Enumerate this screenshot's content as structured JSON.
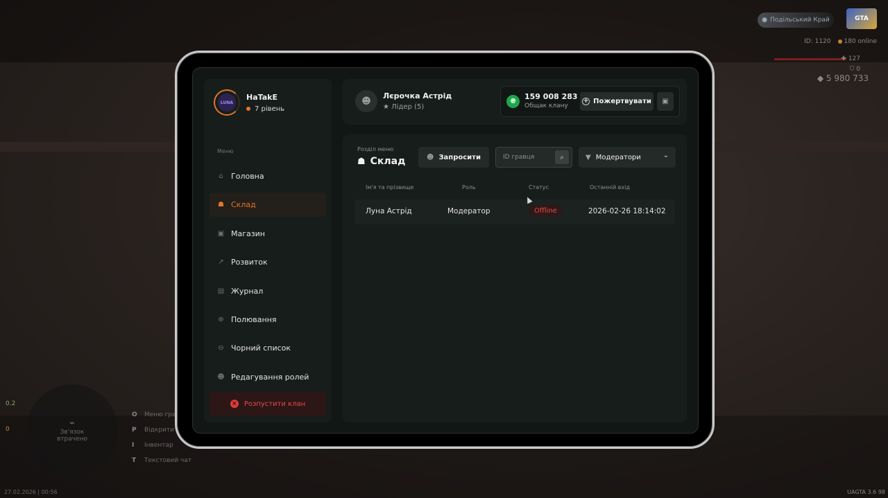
{
  "hud": {
    "server": "Подільський Край",
    "logo": "GTA",
    "id": "ID: 1120",
    "online": "180 online",
    "hp": "127",
    "armor": "0",
    "money": "5 980 733",
    "radar_text": "Зв'язок втрачено",
    "side_stats": [
      "0.2",
      "0"
    ],
    "keys": [
      {
        "key": "O",
        "label": "Меню гравця"
      },
      {
        "key": "P",
        "label": "Відкрити"
      },
      {
        "key": "I",
        "label": "Інвентар"
      },
      {
        "key": "T",
        "label": "Текстовий чат"
      }
    ],
    "datetime": "27.02.2026 | 00:56",
    "version": "UAGTA 3.6",
    "version_extra": "98"
  },
  "profile": {
    "name": "HaTakE",
    "level": "7 рівень",
    "avatar_text": "LUNA"
  },
  "sidebar": {
    "caption": "Меню",
    "items": [
      {
        "label": "Головна",
        "icon": "home-icon",
        "glyph": "⌂"
      },
      {
        "label": "Склад",
        "icon": "members-icon",
        "glyph": "☗"
      },
      {
        "label": "Магазин",
        "icon": "shop-icon",
        "glyph": "▣"
      },
      {
        "label": "Розвиток",
        "icon": "chart-icon",
        "glyph": "↗"
      },
      {
        "label": "Журнал",
        "icon": "journal-icon",
        "glyph": "▤"
      },
      {
        "label": "Полювання",
        "icon": "crosshair-icon",
        "glyph": "⊕"
      },
      {
        "label": "Чорний список",
        "icon": "blocked-icon",
        "glyph": "⊖"
      },
      {
        "label": "Редагування ролей",
        "icon": "user-edit-icon",
        "glyph": "☻"
      }
    ],
    "active_index": 1,
    "dissolve_label": "Розпустити клан"
  },
  "leader": {
    "name": "Лєрочка Астрід",
    "role": "Лідер (5)"
  },
  "fund": {
    "value": "159 008 283",
    "label": "Общак клану",
    "donate_label": "Пожертвувати"
  },
  "section": {
    "caption": "Розділ меню",
    "title": "Склад",
    "invite_label": "Запросити",
    "search_placeholder": "ID гравця",
    "filter_value": "Модератори"
  },
  "table": {
    "headers": [
      "Ім'я та прізвище",
      "Роль",
      "Статус",
      "Останній вхід"
    ],
    "rows": [
      {
        "name": "Луна Астрід",
        "role": "Модератор",
        "status": "Offline",
        "last_login": "2026-02-26 18:14:02"
      }
    ]
  }
}
